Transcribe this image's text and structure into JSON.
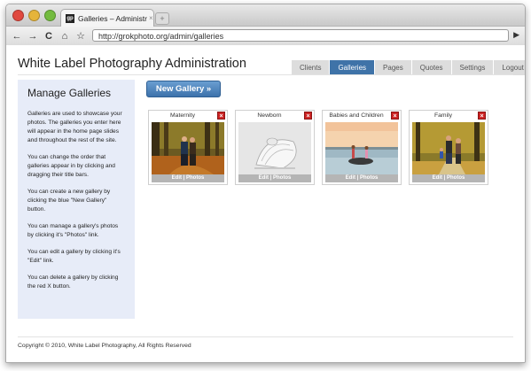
{
  "browser": {
    "tab_title": "Galleries – Administration",
    "tab_close": "×",
    "favicon": "gp",
    "new_tab": "+",
    "url": "http://grokphoto.org/admin/galleries",
    "back": "←",
    "forward": "→",
    "reload": "C",
    "home": "⌂",
    "bookmark": "☆",
    "go": "▶"
  },
  "site": {
    "title": "White Label Photography Administration",
    "nav": [
      "Clients",
      "Galleries",
      "Pages",
      "Quotes",
      "Settings",
      "Logout"
    ],
    "active_nav": "Galleries"
  },
  "sidebar": {
    "heading": "Manage Galleries",
    "paragraphs": [
      "Galleries are used to showcase your photos. The galleries you enter here will appear in the home page slides and throughout the rest of the site.",
      "You can change the order that galleries appear in by clicking and dragging their title bars.",
      "You can create a new gallery by clicking the blue \"New Gallery\" button.",
      "You can manage a gallery's photos by clicking it's \"Photos\" link.",
      "You can edit a gallery by clicking it's \"Edit\" link.",
      "You can delete a gallery by clicking the red X button."
    ]
  },
  "new_gallery_button": "New Gallery »",
  "galleries": [
    {
      "title": "Maternity",
      "links": "Edit | Photos",
      "delete": "×"
    },
    {
      "title": "Newborn",
      "links": "Edit | Photos",
      "delete": "×"
    },
    {
      "title": "Babies and Children",
      "links": "Edit | Photos",
      "delete": "×"
    },
    {
      "title": "Family",
      "links": "Edit | Photos",
      "delete": "×"
    }
  ],
  "footer": "Copyright © 2010, White Label Photography,   All Rights Reserved",
  "colors": {
    "accent": "#3f73a8",
    "sidebar_bg": "#e7ecf8",
    "delete": "#cc2222"
  }
}
